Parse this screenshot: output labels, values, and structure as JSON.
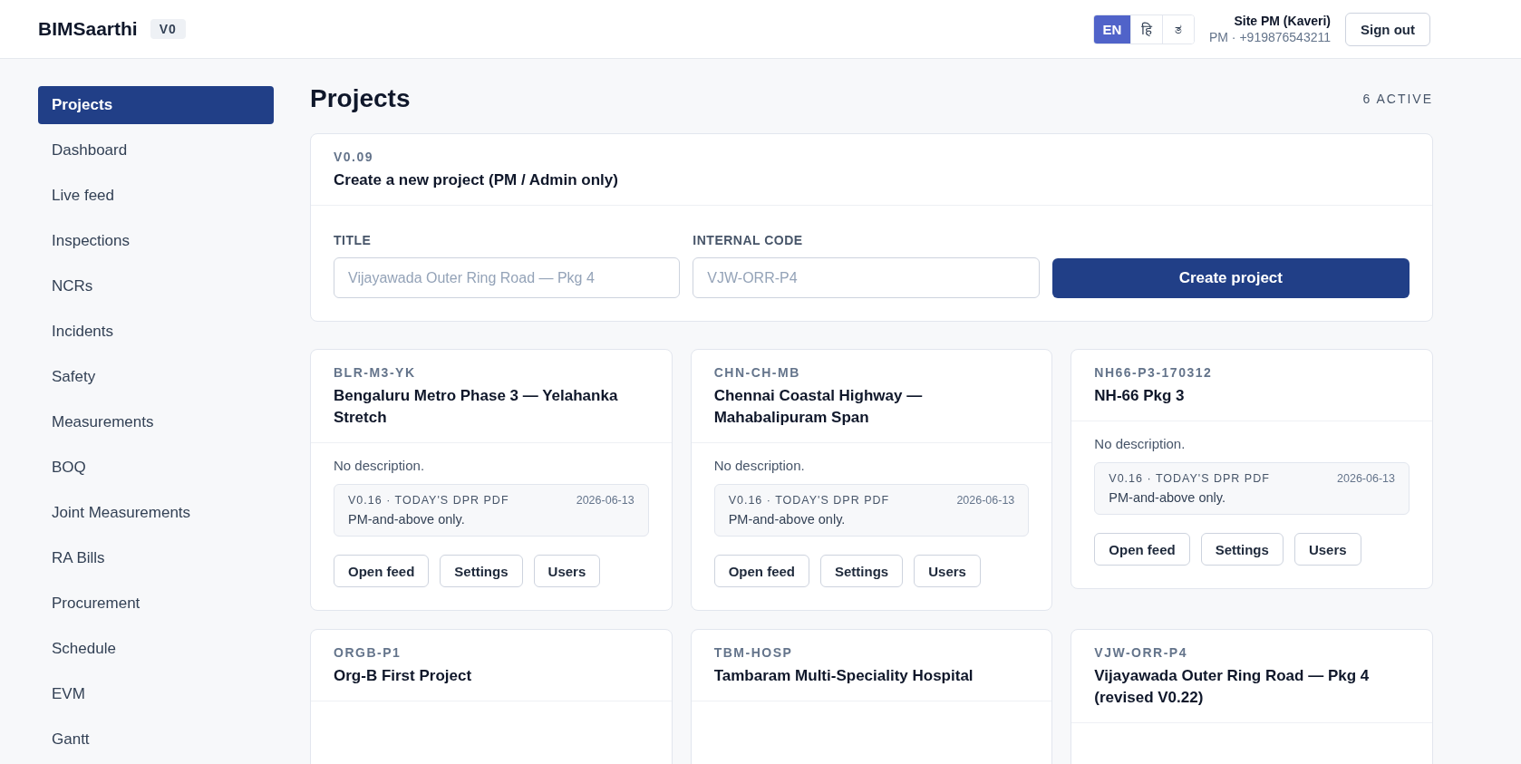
{
  "brand": {
    "name": "BIMSaarthi",
    "version": "V0"
  },
  "languages": [
    {
      "label": "EN",
      "selected": true
    },
    {
      "label": "हि",
      "selected": false
    },
    {
      "label": "ತ",
      "selected": false
    }
  ],
  "user": {
    "name": "Site PM (Kaveri)",
    "detail": "PM · +919876543211"
  },
  "sign_out": "Sign out",
  "sidebar": {
    "items": [
      {
        "label": "Projects",
        "selected": true
      },
      {
        "label": "Dashboard",
        "selected": false
      },
      {
        "label": "Live feed",
        "selected": false
      },
      {
        "label": "Inspections",
        "selected": false
      },
      {
        "label": "NCRs",
        "selected": false
      },
      {
        "label": "Incidents",
        "selected": false
      },
      {
        "label": "Safety",
        "selected": false
      },
      {
        "label": "Measurements",
        "selected": false
      },
      {
        "label": "BOQ",
        "selected": false
      },
      {
        "label": "Joint Measurements",
        "selected": false
      },
      {
        "label": "RA Bills",
        "selected": false
      },
      {
        "label": "Procurement",
        "selected": false
      },
      {
        "label": "Schedule",
        "selected": false
      },
      {
        "label": "EVM",
        "selected": false
      },
      {
        "label": "Gantt",
        "selected": false
      }
    ]
  },
  "page": {
    "title": "Projects",
    "count": "6 ACTIVE"
  },
  "create_form": {
    "version": "V0.09",
    "heading": "Create a new project (PM / Admin only)",
    "fields": [
      {
        "label": "TITLE",
        "placeholder": "Vijayawada Outer Ring Road — Pkg 4"
      },
      {
        "label": "INTERNAL CODE",
        "placeholder": "VJW-ORR-P4"
      }
    ],
    "button": "Create project"
  },
  "projects": [
    {
      "code": "BLR-M3-YK",
      "name": "Bengaluru Metro Phase 3 — Yelahanka Stretch",
      "description": "No description.",
      "dpr": {
        "label": "V0.16 · TODAY'S DPR PDF",
        "date": "2026-06-13",
        "note": "PM-and-above only."
      },
      "actions": [
        "Open feed",
        "Settings",
        "Users"
      ]
    },
    {
      "code": "CHN-CH-MB",
      "name": "Chennai Coastal Highway — Mahabalipuram Span",
      "description": "No description.",
      "dpr": {
        "label": "V0.16 · TODAY'S DPR PDF",
        "date": "2026-06-13",
        "note": "PM-and-above only."
      },
      "actions": [
        "Open feed",
        "Settings",
        "Users"
      ]
    },
    {
      "code": "NH66-P3-170312",
      "name": "NH-66 Pkg 3",
      "description": "No description.",
      "dpr": {
        "label": "V0.16 · TODAY'S DPR PDF",
        "date": "2026-06-13",
        "note": "PM-and-above only."
      },
      "actions": [
        "Open feed",
        "Settings",
        "Users"
      ]
    },
    {
      "code": "ORGB-P1",
      "name": "Org-B First Project"
    },
    {
      "code": "TBM-HOSP",
      "name": "Tambaram Multi-Speciality Hospital"
    },
    {
      "code": "VJW-ORR-P4",
      "name": "Vijayawada Outer Ring Road — Pkg 4 (revised V0.22)"
    }
  ]
}
